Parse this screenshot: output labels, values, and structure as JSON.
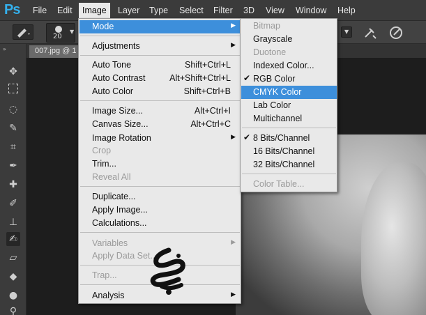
{
  "app": {
    "logo": "Ps"
  },
  "menubar": {
    "items": [
      "File",
      "Edit",
      "Image",
      "Layer",
      "Type",
      "Select",
      "Filter",
      "3D",
      "View",
      "Window",
      "Help"
    ],
    "active": "Image"
  },
  "options": {
    "brush_size": "20"
  },
  "document": {
    "tab": "007.jpg @ 1"
  },
  "image_menu": {
    "mode": "Mode",
    "adjustments": "Adjustments",
    "auto_tone": "Auto Tone",
    "auto_tone_sc": "Shift+Ctrl+L",
    "auto_contrast": "Auto Contrast",
    "auto_contrast_sc": "Alt+Shift+Ctrl+L",
    "auto_color": "Auto Color",
    "auto_color_sc": "Shift+Ctrl+B",
    "image_size": "Image Size...",
    "image_size_sc": "Alt+Ctrl+I",
    "canvas_size": "Canvas Size...",
    "canvas_size_sc": "Alt+Ctrl+C",
    "image_rotation": "Image Rotation",
    "crop": "Crop",
    "trim": "Trim...",
    "reveal_all": "Reveal All",
    "duplicate": "Duplicate...",
    "apply_image": "Apply Image...",
    "calculations": "Calculations...",
    "variables": "Variables",
    "apply_data_set": "Apply Data Set...",
    "trap": "Trap...",
    "analysis": "Analysis"
  },
  "mode_menu": {
    "bitmap": "Bitmap",
    "grayscale": "Grayscale",
    "duotone": "Duotone",
    "indexed": "Indexed Color...",
    "rgb": "RGB Color",
    "cmyk": "CMYK Color",
    "lab": "Lab Color",
    "multichannel": "Multichannel",
    "bits8": "8 Bits/Channel",
    "bits16": "16 Bits/Channel",
    "bits32": "32 Bits/Channel",
    "color_table": "Color Table...",
    "checkmark": "✔"
  },
  "colors": {
    "accent": "#3d8fdb",
    "logo": "#34b0ec"
  }
}
